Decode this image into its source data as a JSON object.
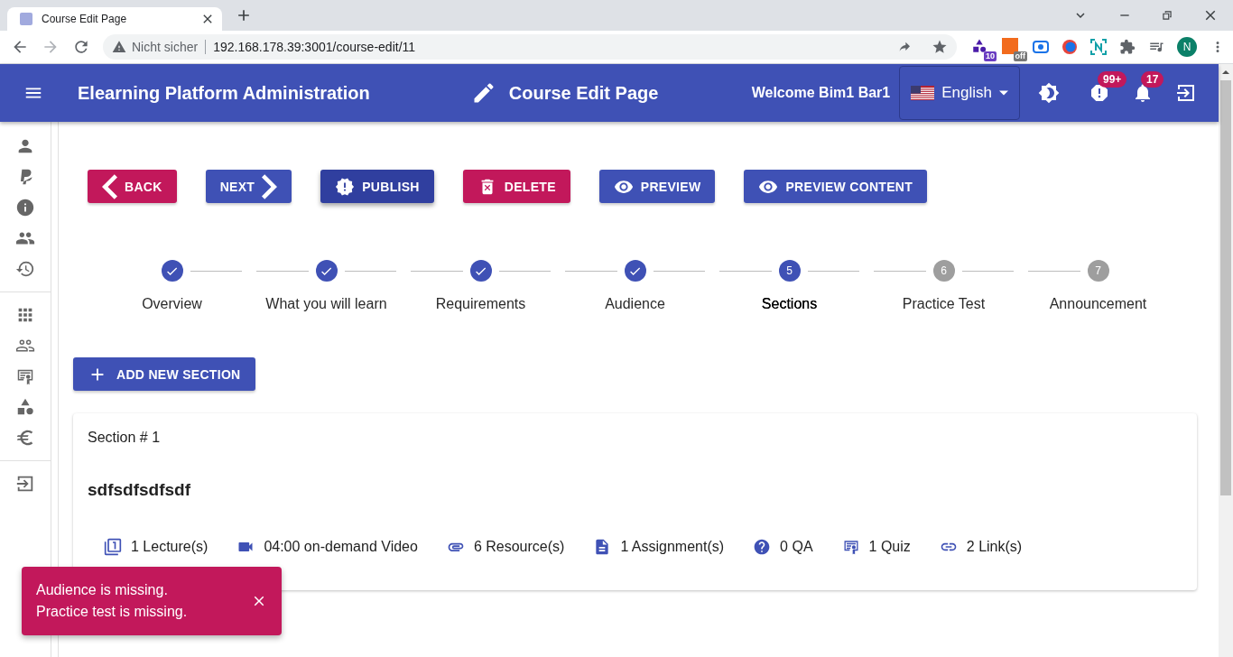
{
  "browser": {
    "tab_title": "Course Edit Page",
    "security": "Nicht sicher",
    "url": "192.168.178.39:3001/course-edit/11",
    "extension_badges": [
      "10",
      "off"
    ],
    "profile_initial": "N"
  },
  "appbar": {
    "title": "Elearning Platform Administration",
    "page_title": "Course Edit Page",
    "welcome": "Welcome Bim1 Bar1",
    "language": "English",
    "alerts_badge": "99+",
    "notifications_badge": "17"
  },
  "actions": [
    {
      "label": "BACK",
      "kind": "back",
      "color": "#c2185b"
    },
    {
      "label": "NEXT",
      "kind": "next",
      "color": "#3f51b5"
    },
    {
      "label": "PUBLISH",
      "kind": "publish",
      "color": "#303f9f"
    },
    {
      "label": "DELETE",
      "kind": "delete",
      "color": "#c2185b"
    },
    {
      "label": "PREVIEW",
      "kind": "preview",
      "color": "#3f51b5"
    },
    {
      "label": "PREVIEW CONTENT",
      "kind": "preview",
      "color": "#3f51b5"
    }
  ],
  "stepper": [
    {
      "label": "Overview",
      "completed": true,
      "selected": false
    },
    {
      "label": "What you will learn",
      "completed": true,
      "selected": false
    },
    {
      "label": "Requirements",
      "completed": true,
      "selected": false
    },
    {
      "label": "Audience",
      "completed": true,
      "selected": false
    },
    {
      "number": "5",
      "label": "Sections",
      "completed": false,
      "selected": true
    },
    {
      "number": "6",
      "label": "Practice Test",
      "completed": false,
      "selected": false
    },
    {
      "number": "7",
      "label": "Announcement",
      "completed": false,
      "selected": false
    }
  ],
  "add_section_button": "ADD NEW SECTION",
  "section": {
    "heading": "Section # 1",
    "title": "sdfsdfsdfsdf",
    "stats": [
      {
        "kind": "lecture",
        "text": "1 Lecture(s)"
      },
      {
        "kind": "video",
        "text": "04:00 on-demand Video"
      },
      {
        "kind": "resource",
        "text": "6 Resource(s)"
      },
      {
        "kind": "assignment",
        "text": "1 Assignment(s)"
      },
      {
        "kind": "qa",
        "text": "0 QA"
      },
      {
        "kind": "quiz",
        "text": "1 Quiz"
      },
      {
        "kind": "link",
        "text": "2 Link(s)"
      }
    ]
  },
  "toast": {
    "lines": [
      "Audience is missing.",
      "Practice test is missing."
    ]
  }
}
